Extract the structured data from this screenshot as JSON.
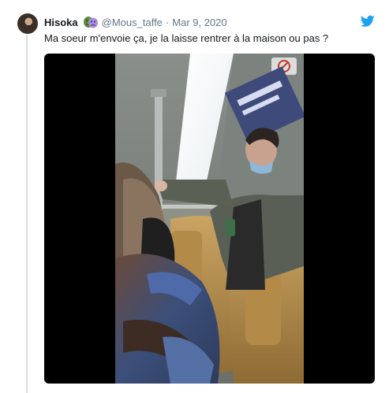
{
  "tweet": {
    "display_name": "Hisoka",
    "name_emoji": "masks-icon",
    "handle": "@Mous_taffe",
    "separator": "·",
    "date": "Mar 9, 2020",
    "text": "Ma soeur m'envoie ça, je la laisse rentrer à la maison ou pas ?",
    "brand_icon": "twitter-bird-icon",
    "brand_color": "#1da1f2"
  },
  "media": {
    "type": "video-thumbnail",
    "scene": "metro-car-interior"
  }
}
